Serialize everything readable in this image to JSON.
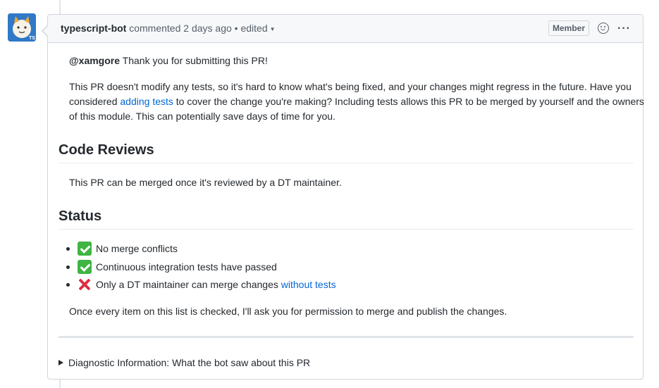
{
  "header": {
    "author": "typescript-bot",
    "action": "commented",
    "time": "2 days ago",
    "separator": "•",
    "edited": "edited",
    "badge": "Member",
    "more": "···"
  },
  "avatar": {
    "badge": "TS"
  },
  "body": {
    "mention": "@xamgore",
    "greeting": "Thank you for submitting this PR!",
    "paragraph2_part1": "This PR doesn't modify any tests, so it's hard to know what's being fixed, and your changes might regress in the future. Have you considered",
    "paragraph2_link": "adding tests",
    "paragraph2_part2": "to cover the change you're making? Including tests allows this PR to be merged by yourself and the owners of this module. This can potentially save days of time for you.",
    "code_reviews_heading": "Code Reviews",
    "code_reviews_text": "This PR can be merged once it's reviewed by a DT maintainer.",
    "status_heading": "Status",
    "status_items": [
      {
        "icon": "check-mark-icon",
        "text": "No merge conflicts"
      },
      {
        "icon": "check-mark-icon",
        "text": "Continuous integration tests have passed"
      },
      {
        "icon": "cross-mark-icon",
        "text": "Only a DT maintainer can merge changes",
        "link": "without tests"
      }
    ],
    "closing": "Once every item on this list is checked, I'll ask you for permission to merge and publish the changes.",
    "details_summary": "Diagnostic Information: What the bot saw about this PR"
  },
  "colors": {
    "link": "#0366d6",
    "border": "#d1d5da",
    "header_bg": "#f6f8fa",
    "check": "#3fb543",
    "cross": "#dd2e44"
  }
}
